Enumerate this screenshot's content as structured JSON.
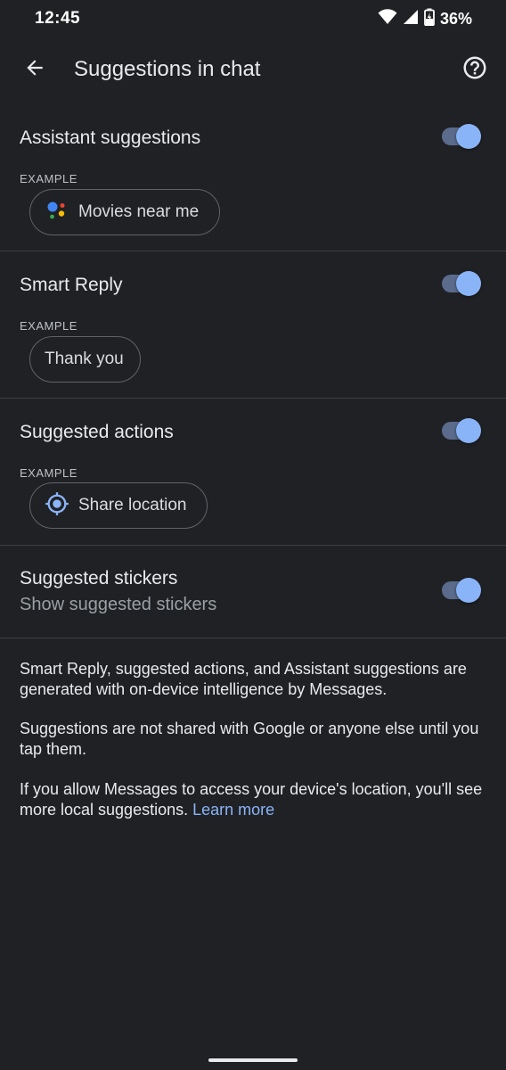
{
  "status_bar": {
    "time": "12:45",
    "battery": "36%",
    "icons": [
      "wifi-icon",
      "signal-icon",
      "battery-charging-icon"
    ]
  },
  "app_bar": {
    "title": "Suggestions in chat",
    "back_icon": "arrow-back-icon",
    "help_icon": "help-circle-icon"
  },
  "sections": [
    {
      "title": "Assistant suggestions",
      "example_label": "EXAMPLE",
      "chip_label": "Movies near me",
      "chip_icon": "google-assistant-icon",
      "toggle_on": true
    },
    {
      "title": "Smart Reply",
      "example_label": "EXAMPLE",
      "chip_label": "Thank you",
      "toggle_on": true
    },
    {
      "title": "Suggested actions",
      "example_label": "EXAMPLE",
      "chip_label": "Share location",
      "chip_icon": "location-target-icon",
      "toggle_on": true
    },
    {
      "title": "Suggested stickers",
      "subtitle": "Show suggested stickers",
      "toggle_on": true
    }
  ],
  "footer": {
    "paragraph1": "Smart Reply, suggested actions, and Assistant suggestions are generated with on-device intelligence by Messages.",
    "paragraph2": "Suggestions are not shared with Google or anyone else until you tap them.",
    "paragraph3": "If you allow Messages to access your device's location, you'll see more local suggestions.",
    "link": "Learn more"
  },
  "colors": {
    "background": "#202124",
    "accent": "#8ab4f8",
    "divider": "#3c4043"
  }
}
